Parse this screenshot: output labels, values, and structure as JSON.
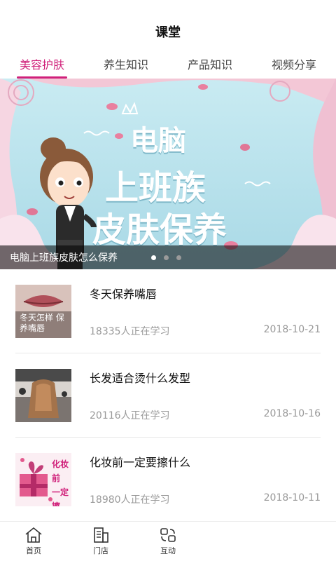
{
  "header": {
    "title": "课堂"
  },
  "tabs": [
    {
      "label": "美容护肤",
      "active": true
    },
    {
      "label": "养生知识",
      "active": false
    },
    {
      "label": "产品知识",
      "active": false
    },
    {
      "label": "视频分享",
      "active": false
    }
  ],
  "banner": {
    "line1": "电脑",
    "line2": "上班族",
    "line3": "皮肤保养",
    "caption": "电脑上班族皮肤怎么保养",
    "slide_count": 3,
    "current_slide": 1
  },
  "articles": [
    {
      "title": "冬天保养嘴唇",
      "learners": "18335人正在学习",
      "date": "2018-10-21",
      "thumb_text": "冬天怎样 保养嘴唇"
    },
    {
      "title": "长发适合烫什么发型",
      "learners": "20116人正在学习",
      "date": "2018-10-16",
      "thumb_text": ""
    },
    {
      "title": "化妆前一定要擦什么",
      "learners": "18980人正在学习",
      "date": "2018-10-11",
      "thumb_text": "化妆前 一定 擦"
    }
  ],
  "tabbar": [
    {
      "label": "首页",
      "icon": "home-icon"
    },
    {
      "label": "门店",
      "icon": "store-icon"
    },
    {
      "label": "互动",
      "icon": "interact-icon"
    }
  ],
  "colors": {
    "accent": "#d0207a"
  }
}
